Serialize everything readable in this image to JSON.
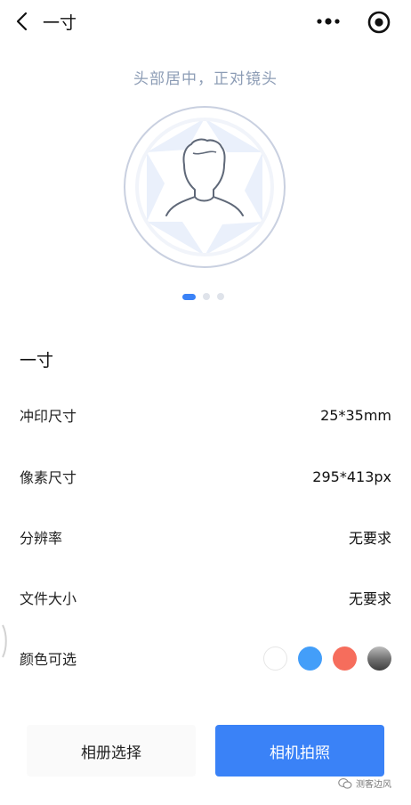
{
  "nav": {
    "title": "一寸",
    "back_icon": "chevron-left-icon",
    "more_icon": "more-dots-icon",
    "target_icon": "target-icon"
  },
  "capture": {
    "hint": "头部居中，正对镜头",
    "illustration_icon": "person-silhouette-icon",
    "carousel_page": 1,
    "carousel_total": 3
  },
  "spec": {
    "title": "一寸",
    "rows": [
      {
        "label": "冲印尺寸",
        "value": "25*35mm"
      },
      {
        "label": "像素尺寸",
        "value": "295*413px"
      },
      {
        "label": "分辨率",
        "value": "无要求"
      },
      {
        "label": "文件大小",
        "value": "无要求"
      }
    ],
    "colors_label": "颜色可选",
    "colors": [
      "#ffffff",
      "#439ef9",
      "#f66d5c",
      "#555555"
    ]
  },
  "actions": {
    "album": "相册选择",
    "camera": "相机拍照"
  },
  "watermark": {
    "text": "测客边风"
  },
  "theme": {
    "accent": "#3a82f7",
    "hint_color": "#8c9cb5"
  }
}
